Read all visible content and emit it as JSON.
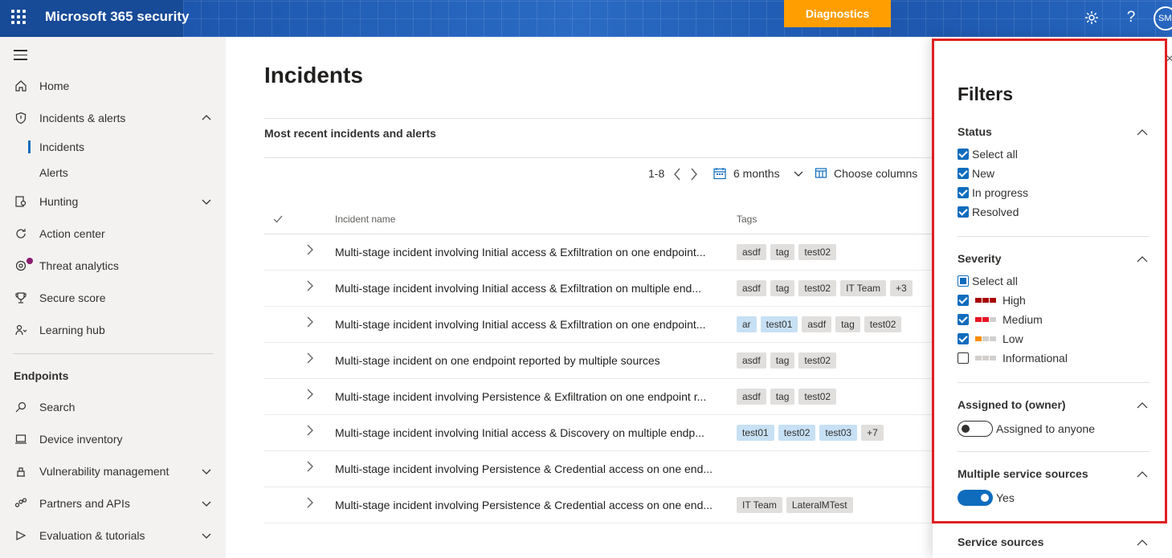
{
  "header": {
    "app_title": "Microsoft 365 security",
    "diagnostics_label": "Diagnostics",
    "avatar_initials": "SM",
    "help_glyph": "?",
    "accent_color": "#ff9e00"
  },
  "nav": {
    "items": [
      {
        "label": "Home",
        "icon": "home-icon"
      },
      {
        "label": "Incidents & alerts",
        "icon": "shield-icon"
      },
      {
        "label": "Incidents"
      },
      {
        "label": "Alerts"
      },
      {
        "label": "Hunting",
        "icon": "hunting-icon"
      },
      {
        "label": "Action center",
        "icon": "action-center-icon"
      },
      {
        "label": "Threat analytics",
        "icon": "threat-analytics-icon"
      },
      {
        "label": "Secure score",
        "icon": "trophy-icon"
      },
      {
        "label": "Learning hub",
        "icon": "learning-hub-icon"
      }
    ],
    "section_endpoints": "Endpoints",
    "endpoint_items": [
      {
        "label": "Search",
        "icon": "search-icon"
      },
      {
        "label": "Device inventory",
        "icon": "device-icon"
      },
      {
        "label": "Vulnerability management",
        "icon": "vulnerability-icon"
      },
      {
        "label": "Partners and APIs",
        "icon": "partners-icon"
      },
      {
        "label": "Evaluation & tutorials",
        "icon": "evaluation-icon"
      }
    ]
  },
  "main": {
    "title": "Incidents",
    "section_title": "Most recent incidents and alerts",
    "pagination": "1-8",
    "time_range": "6 months",
    "choose_columns": "Choose columns",
    "columns": {
      "name": "Incident name",
      "tags": "Tags"
    },
    "rows": [
      {
        "name": "Multi-stage incident involving Initial access & Exfiltration on one endpoint...",
        "tags": [
          {
            "t": "asdf"
          },
          {
            "t": "tag"
          },
          {
            "t": "test02"
          }
        ]
      },
      {
        "name": "Multi-stage incident involving Initial access & Exfiltration on multiple end...",
        "tags": [
          {
            "t": "asdf"
          },
          {
            "t": "tag"
          },
          {
            "t": "test02"
          },
          {
            "t": "IT Team"
          },
          {
            "t": "+3"
          }
        ]
      },
      {
        "name": "Multi-stage incident involving Initial access & Exfiltration on one endpoint...",
        "tags": [
          {
            "t": "ar",
            "blue": true
          },
          {
            "t": "test01",
            "blue": true
          },
          {
            "t": "asdf"
          },
          {
            "t": "tag"
          },
          {
            "t": "test02"
          }
        ]
      },
      {
        "name": "Multi-stage incident on one endpoint reported by multiple sources",
        "tags": [
          {
            "t": "asdf"
          },
          {
            "t": "tag"
          },
          {
            "t": "test02"
          }
        ]
      },
      {
        "name": "Multi-stage incident involving Persistence & Exfiltration on one endpoint r...",
        "tags": [
          {
            "t": "asdf"
          },
          {
            "t": "tag"
          },
          {
            "t": "test02"
          }
        ]
      },
      {
        "name": "Multi-stage incident involving Initial access & Discovery on multiple endp...",
        "tags": [
          {
            "t": "test01",
            "blue": true
          },
          {
            "t": "test02",
            "blue": true
          },
          {
            "t": "test03",
            "blue": true
          },
          {
            "t": "+7"
          }
        ]
      },
      {
        "name": "Multi-stage incident involving Persistence & Credential access on one end...",
        "tags": []
      },
      {
        "name": "Multi-stage incident involving Persistence & Credential access on one end...",
        "tags": [
          {
            "t": "IT Team"
          },
          {
            "t": "LateralMTest"
          }
        ]
      }
    ]
  },
  "filters": {
    "title": "Filters",
    "status": {
      "label": "Status",
      "options": [
        {
          "label": "Select all",
          "checked": true
        },
        {
          "label": "New",
          "checked": true
        },
        {
          "label": "In progress",
          "checked": true
        },
        {
          "label": "Resolved",
          "checked": true
        }
      ]
    },
    "severity": {
      "label": "Severity",
      "options": [
        {
          "label": "Select all",
          "state": "partial"
        },
        {
          "label": "High",
          "state": "checked",
          "bars": [
            "#a80000",
            "#a80000",
            "#a80000"
          ]
        },
        {
          "label": "Medium",
          "state": "checked",
          "bars": [
            "#e81123",
            "#e81123",
            "#d2d0ce"
          ]
        },
        {
          "label": "Low",
          "state": "checked",
          "bars": [
            "#ff8c00",
            "#d2d0ce",
            "#d2d0ce"
          ]
        },
        {
          "label": "Informational",
          "state": "unchecked",
          "bars": [
            "#d2d0ce",
            "#d2d0ce",
            "#d2d0ce"
          ]
        }
      ]
    },
    "assigned": {
      "label": "Assigned to (owner)",
      "toggle_label": "Assigned to anyone",
      "on": false
    },
    "multiple_sources": {
      "label": "Multiple service sources",
      "toggle_label": "Yes",
      "on": true
    },
    "service_sources": {
      "label": "Service sources"
    }
  }
}
